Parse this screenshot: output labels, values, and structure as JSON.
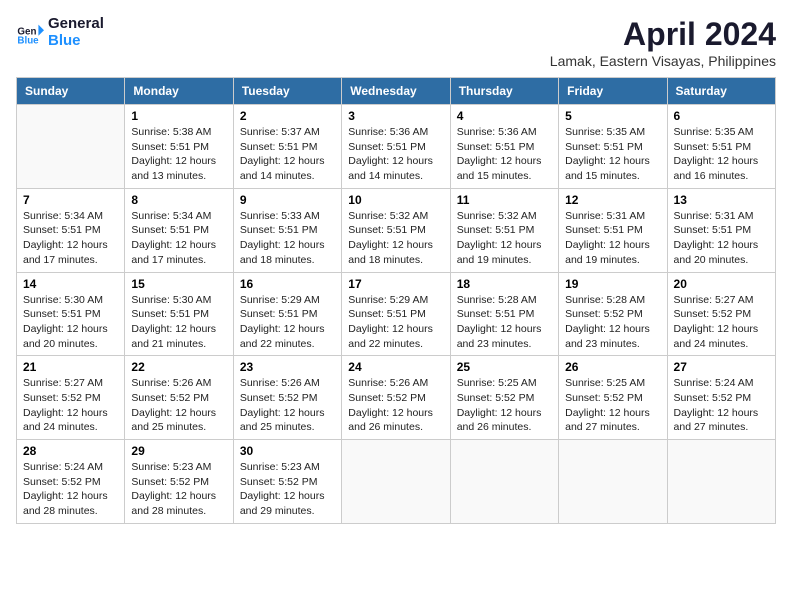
{
  "logo": {
    "line1": "General",
    "line2": "Blue"
  },
  "title": "April 2024",
  "subtitle": "Lamak, Eastern Visayas, Philippines",
  "days_of_week": [
    "Sunday",
    "Monday",
    "Tuesday",
    "Wednesday",
    "Thursday",
    "Friday",
    "Saturday"
  ],
  "weeks": [
    [
      {
        "day": "",
        "info": ""
      },
      {
        "day": "1",
        "info": "Sunrise: 5:38 AM\nSunset: 5:51 PM\nDaylight: 12 hours\nand 13 minutes."
      },
      {
        "day": "2",
        "info": "Sunrise: 5:37 AM\nSunset: 5:51 PM\nDaylight: 12 hours\nand 14 minutes."
      },
      {
        "day": "3",
        "info": "Sunrise: 5:36 AM\nSunset: 5:51 PM\nDaylight: 12 hours\nand 14 minutes."
      },
      {
        "day": "4",
        "info": "Sunrise: 5:36 AM\nSunset: 5:51 PM\nDaylight: 12 hours\nand 15 minutes."
      },
      {
        "day": "5",
        "info": "Sunrise: 5:35 AM\nSunset: 5:51 PM\nDaylight: 12 hours\nand 15 minutes."
      },
      {
        "day": "6",
        "info": "Sunrise: 5:35 AM\nSunset: 5:51 PM\nDaylight: 12 hours\nand 16 minutes."
      }
    ],
    [
      {
        "day": "7",
        "info": "Sunrise: 5:34 AM\nSunset: 5:51 PM\nDaylight: 12 hours\nand 17 minutes."
      },
      {
        "day": "8",
        "info": "Sunrise: 5:34 AM\nSunset: 5:51 PM\nDaylight: 12 hours\nand 17 minutes."
      },
      {
        "day": "9",
        "info": "Sunrise: 5:33 AM\nSunset: 5:51 PM\nDaylight: 12 hours\nand 18 minutes."
      },
      {
        "day": "10",
        "info": "Sunrise: 5:32 AM\nSunset: 5:51 PM\nDaylight: 12 hours\nand 18 minutes."
      },
      {
        "day": "11",
        "info": "Sunrise: 5:32 AM\nSunset: 5:51 PM\nDaylight: 12 hours\nand 19 minutes."
      },
      {
        "day": "12",
        "info": "Sunrise: 5:31 AM\nSunset: 5:51 PM\nDaylight: 12 hours\nand 19 minutes."
      },
      {
        "day": "13",
        "info": "Sunrise: 5:31 AM\nSunset: 5:51 PM\nDaylight: 12 hours\nand 20 minutes."
      }
    ],
    [
      {
        "day": "14",
        "info": "Sunrise: 5:30 AM\nSunset: 5:51 PM\nDaylight: 12 hours\nand 20 minutes."
      },
      {
        "day": "15",
        "info": "Sunrise: 5:30 AM\nSunset: 5:51 PM\nDaylight: 12 hours\nand 21 minutes."
      },
      {
        "day": "16",
        "info": "Sunrise: 5:29 AM\nSunset: 5:51 PM\nDaylight: 12 hours\nand 22 minutes."
      },
      {
        "day": "17",
        "info": "Sunrise: 5:29 AM\nSunset: 5:51 PM\nDaylight: 12 hours\nand 22 minutes."
      },
      {
        "day": "18",
        "info": "Sunrise: 5:28 AM\nSunset: 5:51 PM\nDaylight: 12 hours\nand 23 minutes."
      },
      {
        "day": "19",
        "info": "Sunrise: 5:28 AM\nSunset: 5:52 PM\nDaylight: 12 hours\nand 23 minutes."
      },
      {
        "day": "20",
        "info": "Sunrise: 5:27 AM\nSunset: 5:52 PM\nDaylight: 12 hours\nand 24 minutes."
      }
    ],
    [
      {
        "day": "21",
        "info": "Sunrise: 5:27 AM\nSunset: 5:52 PM\nDaylight: 12 hours\nand 24 minutes."
      },
      {
        "day": "22",
        "info": "Sunrise: 5:26 AM\nSunset: 5:52 PM\nDaylight: 12 hours\nand 25 minutes."
      },
      {
        "day": "23",
        "info": "Sunrise: 5:26 AM\nSunset: 5:52 PM\nDaylight: 12 hours\nand 25 minutes."
      },
      {
        "day": "24",
        "info": "Sunrise: 5:26 AM\nSunset: 5:52 PM\nDaylight: 12 hours\nand 26 minutes."
      },
      {
        "day": "25",
        "info": "Sunrise: 5:25 AM\nSunset: 5:52 PM\nDaylight: 12 hours\nand 26 minutes."
      },
      {
        "day": "26",
        "info": "Sunrise: 5:25 AM\nSunset: 5:52 PM\nDaylight: 12 hours\nand 27 minutes."
      },
      {
        "day": "27",
        "info": "Sunrise: 5:24 AM\nSunset: 5:52 PM\nDaylight: 12 hours\nand 27 minutes."
      }
    ],
    [
      {
        "day": "28",
        "info": "Sunrise: 5:24 AM\nSunset: 5:52 PM\nDaylight: 12 hours\nand 28 minutes."
      },
      {
        "day": "29",
        "info": "Sunrise: 5:23 AM\nSunset: 5:52 PM\nDaylight: 12 hours\nand 28 minutes."
      },
      {
        "day": "30",
        "info": "Sunrise: 5:23 AM\nSunset: 5:52 PM\nDaylight: 12 hours\nand 29 minutes."
      },
      {
        "day": "",
        "info": ""
      },
      {
        "day": "",
        "info": ""
      },
      {
        "day": "",
        "info": ""
      },
      {
        "day": "",
        "info": ""
      }
    ]
  ]
}
